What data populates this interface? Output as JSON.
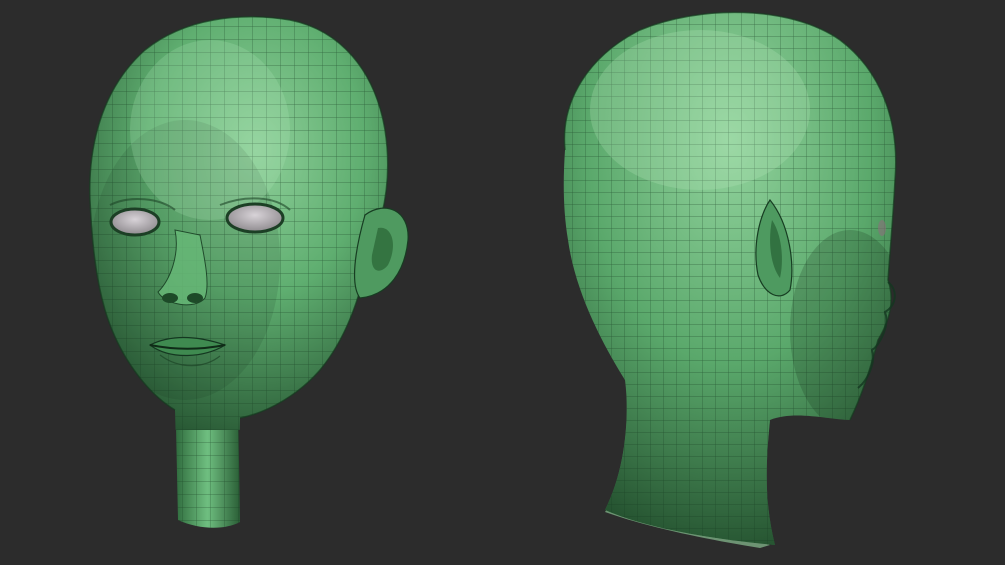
{
  "scene": {
    "background_color": "#2c2c2c",
    "mesh_color_light": "#8fd09a",
    "mesh_color_mid": "#5fae70",
    "mesh_color_dark": "#1f4a2a",
    "wire_color": "#163a20",
    "eye_color": "#b9b4b9",
    "models": [
      {
        "view": "front",
        "icon": "head-front-icon"
      },
      {
        "view": "three-quarter-back",
        "icon": "head-back-icon"
      }
    ]
  }
}
